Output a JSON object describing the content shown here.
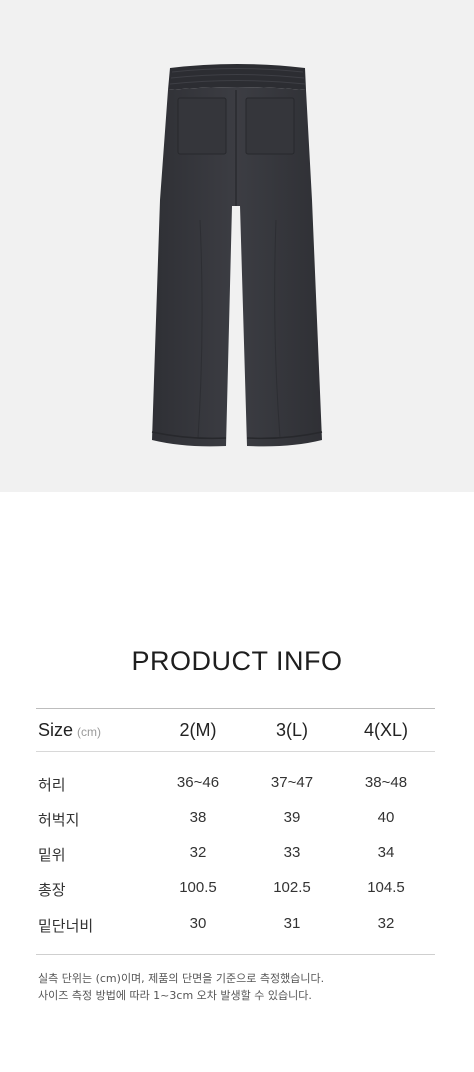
{
  "title": "PRODUCT INFO",
  "table": {
    "header_label": "Size",
    "header_unit": "(cm)",
    "columns": [
      "2(M)",
      "3(L)",
      "4(XL)"
    ],
    "rows": [
      {
        "label": "허리",
        "values": [
          "36~46",
          "37~47",
          "38~48"
        ]
      },
      {
        "label": "허벅지",
        "values": [
          "38",
          "39",
          "40"
        ]
      },
      {
        "label": "밑위",
        "values": [
          "32",
          "33",
          "34"
        ]
      },
      {
        "label": "총장",
        "values": [
          "100.5",
          "102.5",
          "104.5"
        ]
      },
      {
        "label": "밑단너비",
        "values": [
          "30",
          "31",
          "32"
        ]
      }
    ]
  },
  "notes": [
    "실측 단위는 (cm)이며, 제품의 단면을 기준으로 측정했습니다.",
    "사이즈 측정 방법에 따라 1~3cm 오차 발생할 수 있습니다."
  ],
  "colors": {
    "hero_background": "#f1f1f1",
    "garment": "#3a3b40"
  }
}
